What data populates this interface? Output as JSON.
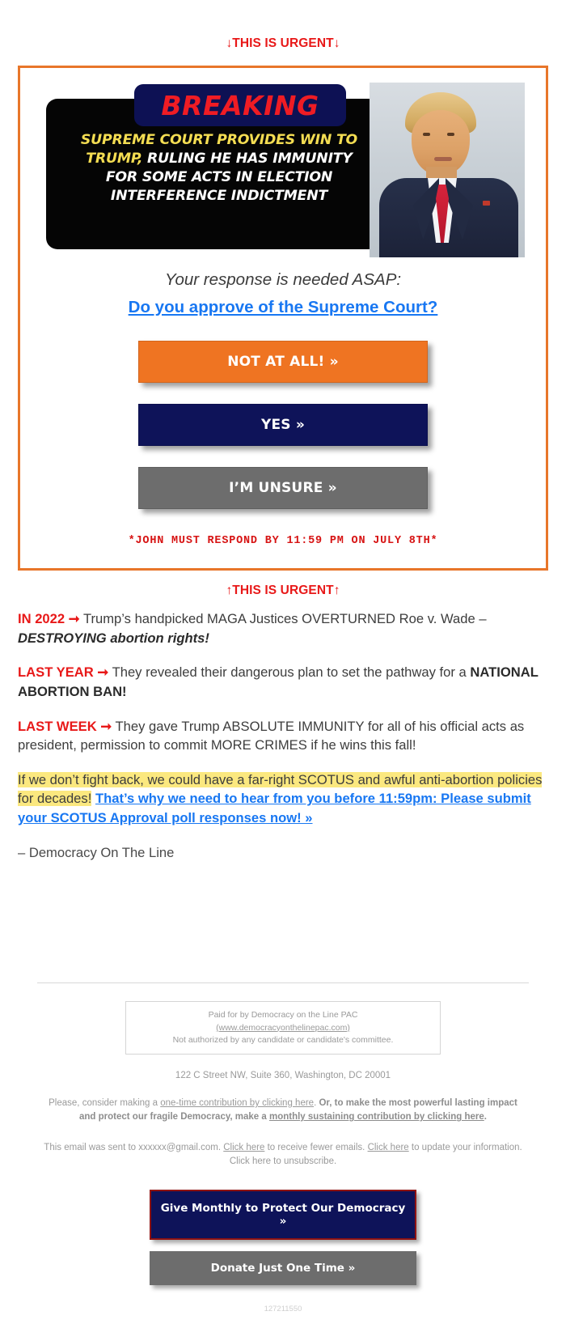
{
  "urgent_top": "↓THIS IS URGENT↓",
  "urgent_mid": "↑THIS IS URGENT↑",
  "news": {
    "badge": "BREAKING",
    "line1_highlight": "SUPREME COURT PROVIDES WIN TO",
    "line2_highlight": "TRUMP,",
    "line2_rest": " RULING HE HAS IMMUNITY",
    "line3": "FOR SOME ACTS IN ELECTION",
    "line4": "INTERFERENCE INDICTMENT"
  },
  "question": {
    "lead": "Your response is needed ASAP:",
    "link": "Do you approve of the Supreme Court?"
  },
  "poll_buttons": [
    {
      "label": "NOT AT ALL! »",
      "color": "#ef7422"
    },
    {
      "label": "YES »",
      "color": "#0e1359"
    },
    {
      "label": "I’M UNSURE »",
      "color": "#6d6d6d"
    }
  ],
  "deadline": "*JOHN MUST RESPOND BY 11:59 PM ON JULY 8TH*",
  "paragraphs": {
    "p1_lede": "IN 2022 ➞",
    "p1_text": " Trump’s handpicked MAGA Justices OVERTURNED Roe v. Wade – ",
    "p1_bold_italic": "DESTROYING abortion rights!",
    "p2_lede": "LAST YEAR ➞",
    "p2_text": " They revealed their dangerous plan to set the pathway for a ",
    "p2_bold": "NATIONAL ABORTION BAN!",
    "p3_lede": "LAST WEEK ➞",
    "p3_text": " They gave Trump ABSOLUTE IMMUNITY for all of his official acts as president, permission to commit MORE CRIMES if he wins this fall!",
    "p4_highlight": "If we don’t fight back, we could have a far-right SCOTUS and awful anti-abortion policies for decades!",
    "p4_link": "That’s why we need to hear from you before 11:59pm: Please submit your SCOTUS Approval poll responses now! »"
  },
  "signoff": "– Democracy On The Line",
  "footer": {
    "disclaimer_line1": "Paid for by Democracy on the Line PAC",
    "disclaimer_url": "(www.democracyonthelinepac.com)",
    "disclaimer_line3": "Not authorized by any candidate or candidate's committee.",
    "address": "122 C Street NW, Suite 360, Washington, DC 20001",
    "ask_pre": "Please, consider making a ",
    "ask_link1": "one-time contribution by clicking here",
    "ask_mid": ". ",
    "ask_bold": "Or, to make the most powerful lasting impact and protect our fragile Democracy, make a ",
    "ask_link2": "monthly sustaining contribution by clicking here",
    "ask_end": ".",
    "sent_pre": "This email was sent to xxxxxx@gmail.com. ",
    "sent_link1": "Click here",
    "sent_mid1": " to receive fewer emails. ",
    "sent_link2": "Click here",
    "sent_mid2": " to update your information. Click here to unsubscribe.",
    "btn_monthly": "Give Monthly to Protect Our Democracy »",
    "btn_once": "Donate Just One Time »",
    "id": "127211550"
  }
}
